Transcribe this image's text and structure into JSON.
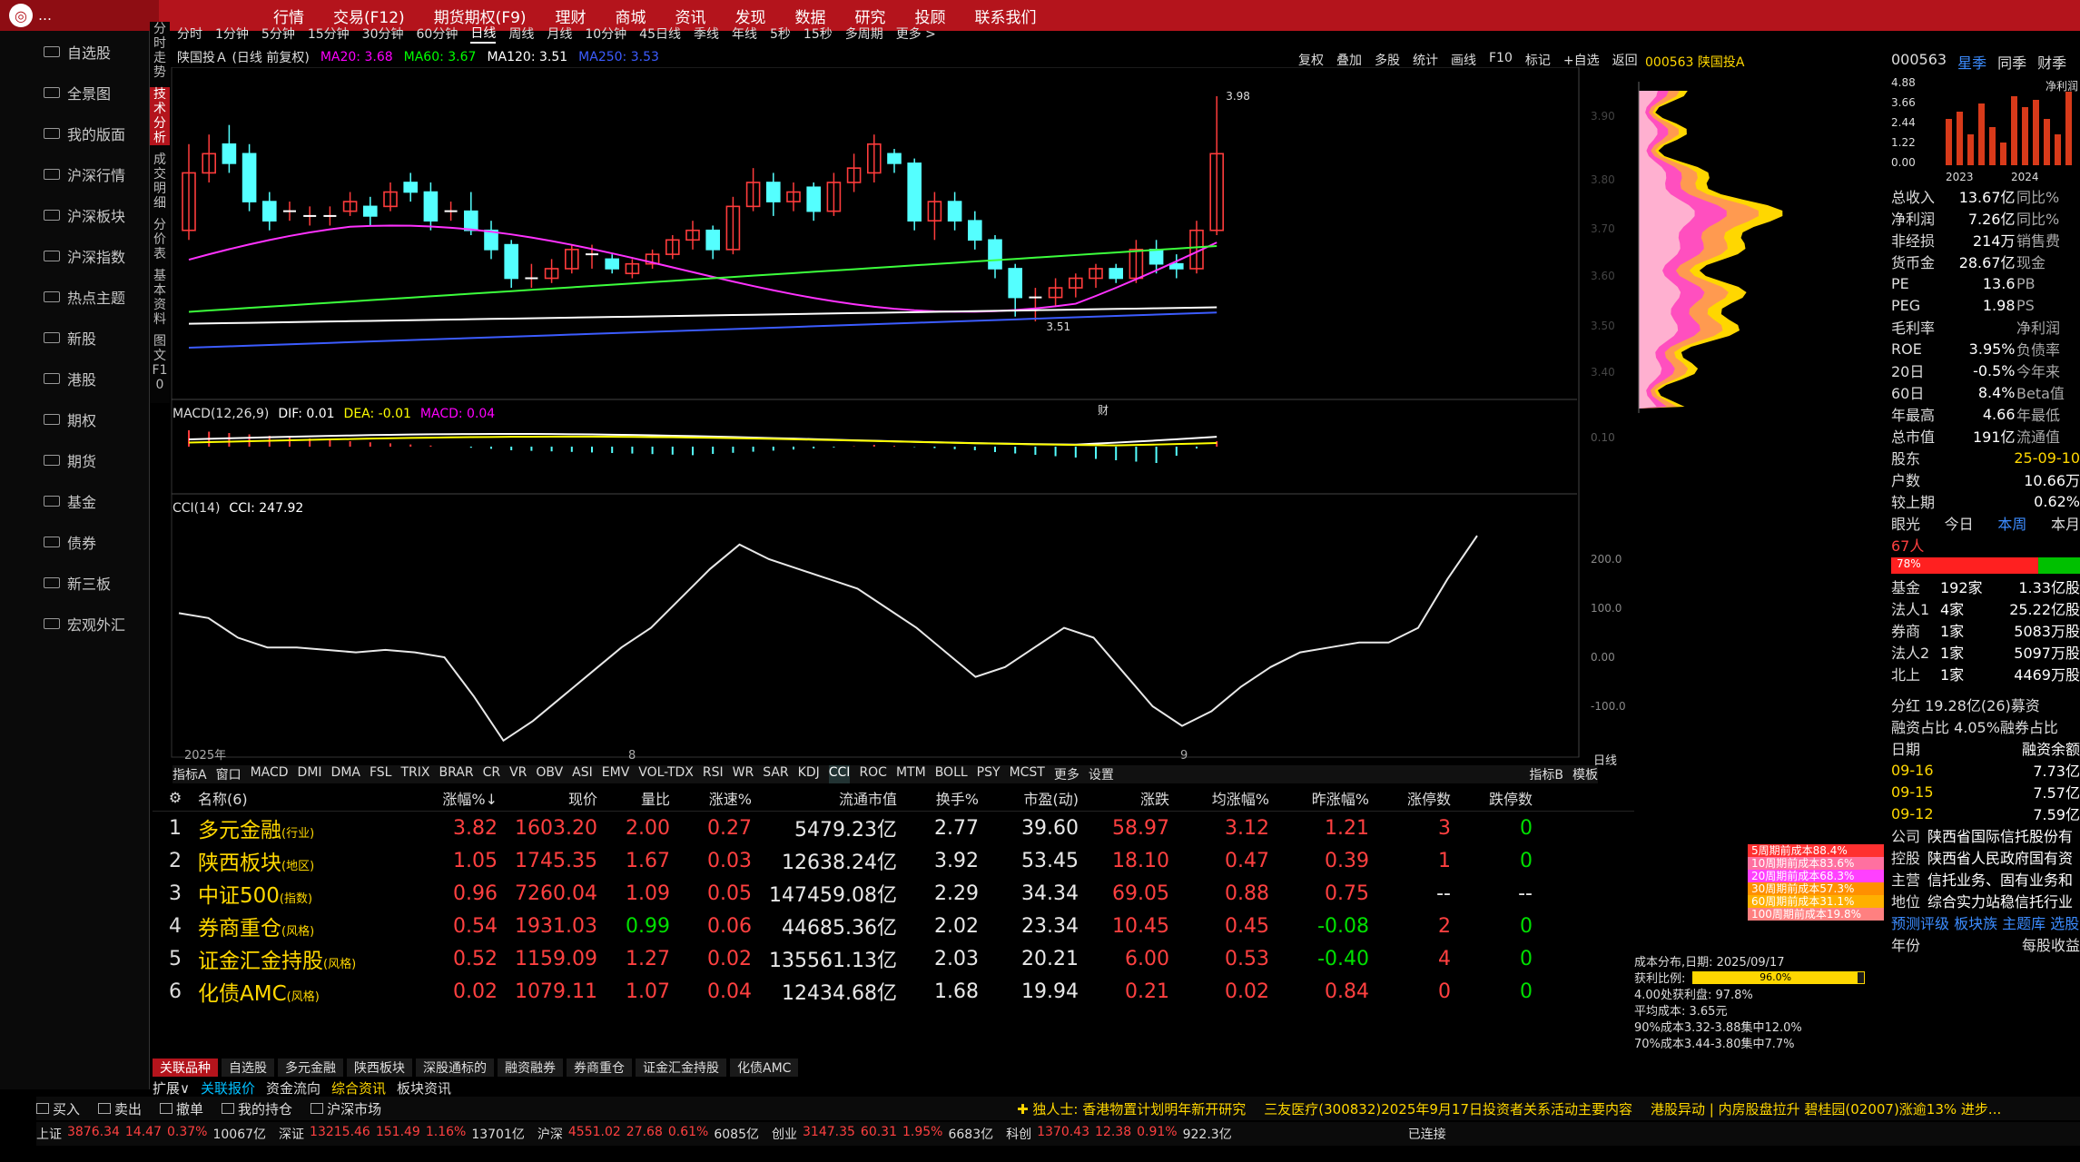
{
  "top_menu": {
    "logo": "…",
    "items": [
      "行情",
      "交易(F12)",
      "期货期权(F9)",
      "理财",
      "商城",
      "资讯",
      "发现",
      "数据",
      "研究",
      "投顾",
      "联系我们"
    ]
  },
  "sidebar": [
    "自选股",
    "全景图",
    "我的版面",
    "沪深行情",
    "沪深板块",
    "沪深指数",
    "热点主题",
    "新股",
    "港股",
    "期权",
    "期货",
    "基金",
    "债券",
    "新三板",
    "宏观外汇"
  ],
  "vtabs": [
    "分时走势",
    "技术分析",
    "成交明细",
    "分价表",
    "基本资料",
    "图文F10"
  ],
  "period_bar": {
    "items": [
      "分时",
      "1分钟",
      "5分钟",
      "15分钟",
      "30分钟",
      "60分钟",
      "日线",
      "周线",
      "月线",
      "10分钟",
      "45日线",
      "季线",
      "年线",
      "5秒",
      "15秒",
      "多周期",
      "更多 >"
    ],
    "active": "日线"
  },
  "main_header": {
    "title": "陕国投Ａ (日线 前复权)",
    "ma20": "MA20: 3.68",
    "ma60": "MA60: 3.67",
    "ma120": "MA120: 3.51",
    "ma250": "MA250: 3.53"
  },
  "tools": [
    "复权",
    "叠加",
    "多股",
    "统计",
    "画线",
    "F10",
    "标记",
    "+自选",
    "返回"
  ],
  "stock_code_title": "000563 陕国投A",
  "chart_labels": {
    "high": "3.98",
    "low": "3.51",
    "year": "2025年",
    "m8": "8",
    "m9": "9",
    "cai": "财",
    "daxian": "日线"
  },
  "price_axis": [
    "3.90",
    "3.80",
    "3.70",
    "3.60",
    "3.50",
    "3.40"
  ],
  "macd": {
    "name": "MACD(12,26,9)",
    "dif": "DIF: 0.01",
    "dea": "DEA: -0.01",
    "macd": "MACD: 0.04",
    "axis": "0.10"
  },
  "cci": {
    "name": "CCI(14)",
    "value": "CCI: 247.92",
    "axis": [
      "200.0",
      "100.0",
      "0.00",
      "-100.0"
    ]
  },
  "ind_tabs": {
    "items": [
      "指标A",
      "窗口",
      "MACD",
      "DMI",
      "DMA",
      "FSL",
      "TRIX",
      "BRAR",
      "CR",
      "VR",
      "OBV",
      "ASI",
      "EMV",
      "VOL-TDX",
      "RSI",
      "WR",
      "SAR",
      "KDJ",
      "CCI",
      "ROC",
      "MTM",
      "BOLL",
      "PSY",
      "MCST",
      "更多",
      "设置"
    ],
    "active": "CCI",
    "right": [
      "指标B",
      "模板"
    ]
  },
  "table": {
    "headers": [
      "名称(6)",
      "涨幅%↓",
      "现价",
      "量比",
      "涨速%",
      "流通市值",
      "换手%",
      "市盈(动)",
      "涨跌",
      "均涨幅%",
      "昨涨幅%",
      "涨停数",
      "跌停数"
    ],
    "rows": [
      {
        "n": "1",
        "name": "多元金融",
        "tag": "(行业)",
        "cells": [
          "3.82",
          "1603.20",
          "2.00",
          "0.27",
          "5479.23亿",
          "2.77",
          "39.60",
          "58.97",
          "3.12",
          "1.21",
          "3",
          "0"
        ]
      },
      {
        "n": "2",
        "name": "陕西板块",
        "tag": "(地区)",
        "cells": [
          "1.05",
          "1745.35",
          "1.67",
          "0.03",
          "12638.24亿",
          "3.92",
          "53.45",
          "18.10",
          "0.47",
          "0.39",
          "1",
          "0"
        ]
      },
      {
        "n": "3",
        "name": "中证500",
        "tag": "(指数)",
        "cells": [
          "0.96",
          "7260.04",
          "1.09",
          "0.05",
          "147459.08亿",
          "2.29",
          "34.34",
          "69.05",
          "0.88",
          "0.75",
          "--",
          "--"
        ]
      },
      {
        "n": "4",
        "name": "券商重仓",
        "tag": "(风格)",
        "cells": [
          "0.54",
          "1931.03",
          "0.99",
          "0.06",
          "44685.36亿",
          "2.02",
          "23.34",
          "10.45",
          "0.45",
          "-0.08",
          "2",
          "0"
        ]
      },
      {
        "n": "5",
        "name": "证金汇金持股",
        "tag": "(风格)",
        "cells": [
          "0.52",
          "1159.09",
          "1.27",
          "0.02",
          "135561.13亿",
          "2.03",
          "20.21",
          "6.00",
          "0.53",
          "-0.40",
          "4",
          "0"
        ]
      },
      {
        "n": "6",
        "name": "化债AMC",
        "tag": "(风格)",
        "cells": [
          "0.02",
          "1079.11",
          "1.07",
          "0.04",
          "12434.68亿",
          "1.68",
          "19.94",
          "0.21",
          "0.02",
          "0.84",
          "0",
          "0"
        ]
      }
    ]
  },
  "bottom_tabs": [
    "关联品种",
    "自选股",
    "多元金融",
    "陕西板块",
    "深股通标的",
    "融资融券",
    "券商重仓",
    "证金汇金持股",
    "化债AMC"
  ],
  "tabs2": [
    "扩展∨",
    "关联报价",
    "资金流向",
    "综合资讯",
    "板块资讯"
  ],
  "status1": {
    "items": [
      "买入",
      "卖出",
      "撤单",
      "我的持仓",
      "沪深市场"
    ],
    "news1": "✚ 独人士: 香港物置计划明年新开研究",
    "news2": "三友医疗(300832)2025年9月17日投资者关系活动主要内容",
    "news3": "港股异动 | 内房股盘拉升 碧桂园(02007)涨逾13% 进步..."
  },
  "status2": [
    {
      "label": "上证",
      "v": "3876.34",
      "c": "14.47",
      "p": "0.37%",
      "amt": "10067亿"
    },
    {
      "label": "深证",
      "v": "13215.46",
      "c": "151.49",
      "p": "1.16%",
      "amt": "13701亿"
    },
    {
      "label": "沪深",
      "v": "4551.02",
      "c": "27.68",
      "p": "0.61%",
      "amt": "6085亿"
    },
    {
      "label": "创业",
      "v": "3147.35",
      "c": "60.31",
      "p": "1.95%",
      "amt": "6683亿"
    },
    {
      "label": "科创",
      "v": "1370.43",
      "c": "12.38",
      "p": "0.91%",
      "amt": "922.3亿"
    }
  ],
  "status2_right": "已连接",
  "cost_legend": [
    "5周期前成本88.4%",
    "10周期前成本83.6%",
    "20周期前成本68.3%",
    "30周期前成本57.3%",
    "60周期前成本31.1%",
    "100周期前成本19.8%"
  ],
  "dist_info": [
    "成本分布,日期: 2025/09/17",
    "获利比例:",
    "4.00处获利盘: 97.8%",
    "平均成本: 3.65元",
    "90%成本3.32-3.88集中12.0%",
    "70%成本3.44-3.80集中7.7%"
  ],
  "dist_ratio": "96.0%",
  "right": {
    "code": "000563",
    "tab1": "星季",
    "tab2": "同季",
    "tab3": "财季",
    "axis": [
      "4.88",
      "3.66",
      "2.44",
      "1.22",
      "0.00"
    ],
    "years": [
      "2023",
      "2024"
    ],
    "jinglirun": "净利润",
    "fin": [
      [
        "总收入",
        "13.67亿",
        "同比%"
      ],
      [
        "净利润",
        "7.26亿",
        "同比%"
      ],
      [
        "非经损",
        "214万",
        "销售费"
      ],
      [
        "货币金",
        "28.67亿",
        "现金"
      ],
      [
        "PE",
        "13.6",
        "PB"
      ],
      [
        "PEG",
        "1.98",
        "PS"
      ],
      [
        "毛利率",
        "",
        "净利润"
      ],
      [
        "ROE",
        "3.95%",
        "负债率"
      ],
      [
        "20日",
        "-0.5%",
        "今年来"
      ],
      [
        "60日",
        "8.4%",
        "Beta值"
      ],
      [
        "年最高",
        "4.66",
        "年最低"
      ],
      [
        "总市值",
        "191亿",
        "流通值"
      ]
    ],
    "holders_date": "25-09-10",
    "holders": [
      [
        "股东",
        "",
        ""
      ],
      [
        "户数",
        "10.66万",
        ""
      ],
      [
        "较上期",
        "0.62%",
        ""
      ]
    ],
    "eye": "眼光",
    "today": "今日",
    "week": "本周",
    "bench": "本月",
    "jigou": "67人",
    "ratio": "78%",
    "inst": [
      [
        "基金",
        "192家",
        "1.33亿股"
      ],
      [
        "法人1",
        "4家",
        "25.22亿股"
      ],
      [
        "券商",
        "1家",
        "5083万股"
      ],
      [
        "法人2",
        "1家",
        "5097万股"
      ],
      [
        "北上",
        "1家",
        "4469万股"
      ]
    ],
    "fenhong": "分红  19.28亿(26)募资",
    "rz": "融资占比  4.05%融券占比",
    "rz_table": [
      [
        "日期",
        "融资余额"
      ],
      [
        "09-16",
        "7.73亿"
      ],
      [
        "09-15",
        "7.57亿"
      ],
      [
        "09-12",
        "7.59亿"
      ]
    ],
    "company": [
      [
        "公司",
        "陕西省国际信托股份有"
      ],
      [
        "控股",
        "陕西省人民政府国有资"
      ],
      [
        "主营",
        "信托业务、固有业务和"
      ],
      [
        "地位",
        "综合实力站稳信托行业"
      ]
    ],
    "yc": "预测评级 板块族 主题库 选股",
    "nianfen": "年份",
    "meigu": "每股收益"
  }
}
